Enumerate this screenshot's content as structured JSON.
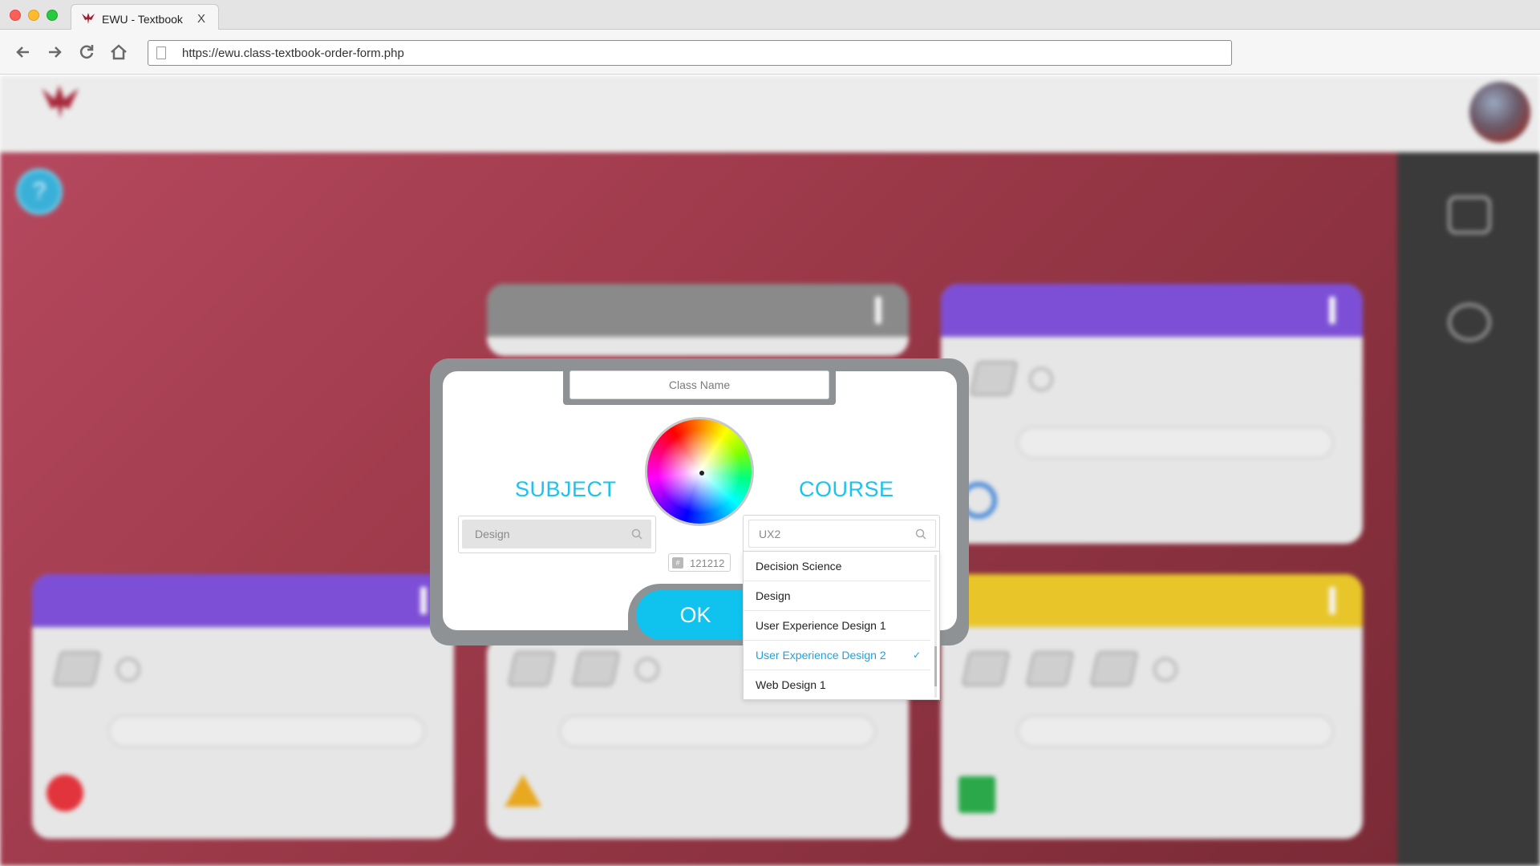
{
  "browser": {
    "tab_title": "EWU - Textbook",
    "tab_close": "X",
    "url": "https://ewu.class-textbook-order-form.php"
  },
  "modal": {
    "class_name_placeholder": "Class Name",
    "subject_label": "SUBJECT",
    "course_label": "COURSE",
    "subject_value": "Design",
    "course_value": "UX2",
    "color_hex": "121212",
    "color_hash": "#",
    "ok_label": "OK",
    "course_options": [
      {
        "label": "Decision Science",
        "selected": false
      },
      {
        "label": "Design",
        "selected": false
      },
      {
        "label": "User Experience Design 1",
        "selected": false
      },
      {
        "label": "User Experience Design 2",
        "selected": true
      },
      {
        "label": "Web Design 1",
        "selected": false
      }
    ],
    "check_mark": "✓"
  },
  "colors": {
    "accent": "#1bc3ee",
    "ok_button": "#0fc3ee",
    "selected_option": "#1aa3e0",
    "modal_frame": "#8f9294",
    "page_background": "#9a3848",
    "card_purple": "#7d4fd6",
    "card_yellow": "#e8c62a",
    "card_gray": "#8c8c8c"
  },
  "icons": {
    "back": "arrow-left-icon",
    "forward": "arrow-right-icon",
    "reload": "reload-icon",
    "home": "home-icon",
    "search": "search-icon",
    "help": "help-icon",
    "check": "check-icon"
  }
}
